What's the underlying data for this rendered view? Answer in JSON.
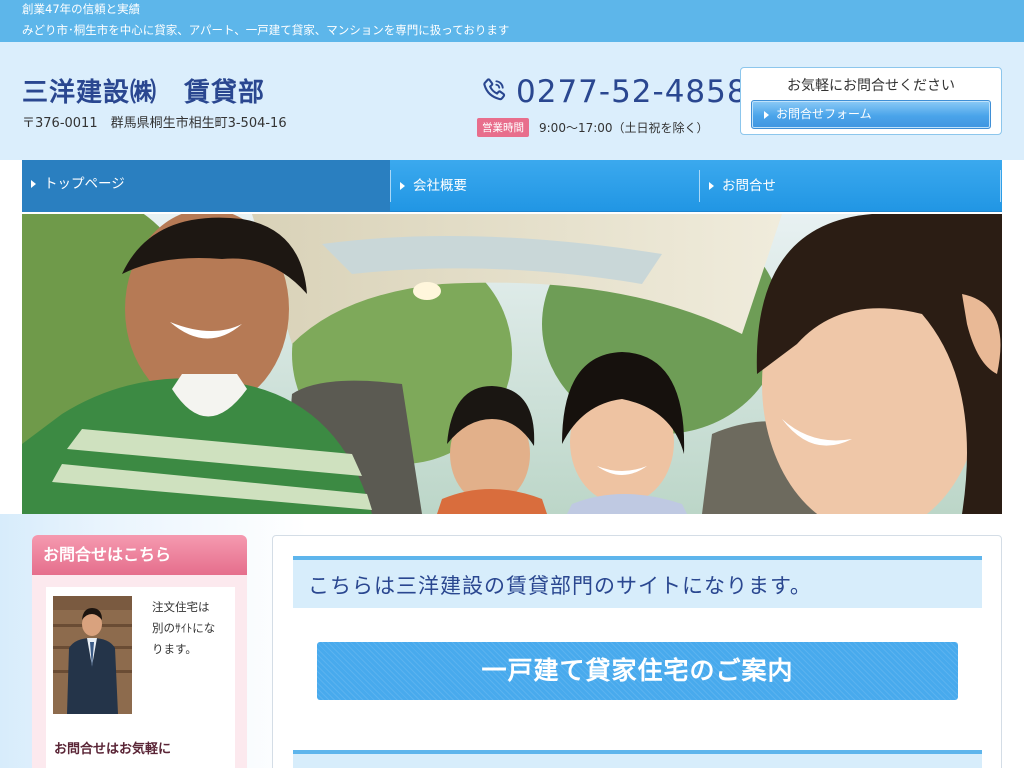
{
  "top_strip": {
    "tagline": "創業47年の信頼と実績",
    "description": "みどり市･桐生市を中心に貸家、アパート、一戸建て貸家、マンションを専門に扱っております"
  },
  "header": {
    "site_title": "三洋建設㈱　賃貸部",
    "address": "〒376-0011　群馬県桐生市相生町3-504-16",
    "phone_icon": "phone-icon",
    "phone": "0277-52-4858",
    "hours_badge": "営業時間",
    "hours": "9:00～17:00（土日祝を除く）",
    "contact_caption": "お気軽にお問合せください",
    "contact_button": "お問合せフォーム"
  },
  "nav": {
    "items": [
      {
        "label": "トップページ",
        "active": true
      },
      {
        "label": "会社概要",
        "active": false
      },
      {
        "label": "お問合せ",
        "active": false
      }
    ]
  },
  "sidebar": {
    "heading": "お問合せはこちら",
    "note_lines": [
      "注文住宅は",
      "別のｻｲﾄにな",
      "ります。"
    ],
    "sub_heading": "お問合せはお気軽に"
  },
  "main": {
    "heading": "こちらは三洋建設の賃貸部門のサイトになります。",
    "banner_button": "一戸建て貸家住宅のご案内"
  },
  "colors": {
    "accent_blue": "#2196e4",
    "title_navy": "#2a4790",
    "pink": "#e56e8c",
    "light_blue_bg": "#dbeefc"
  }
}
